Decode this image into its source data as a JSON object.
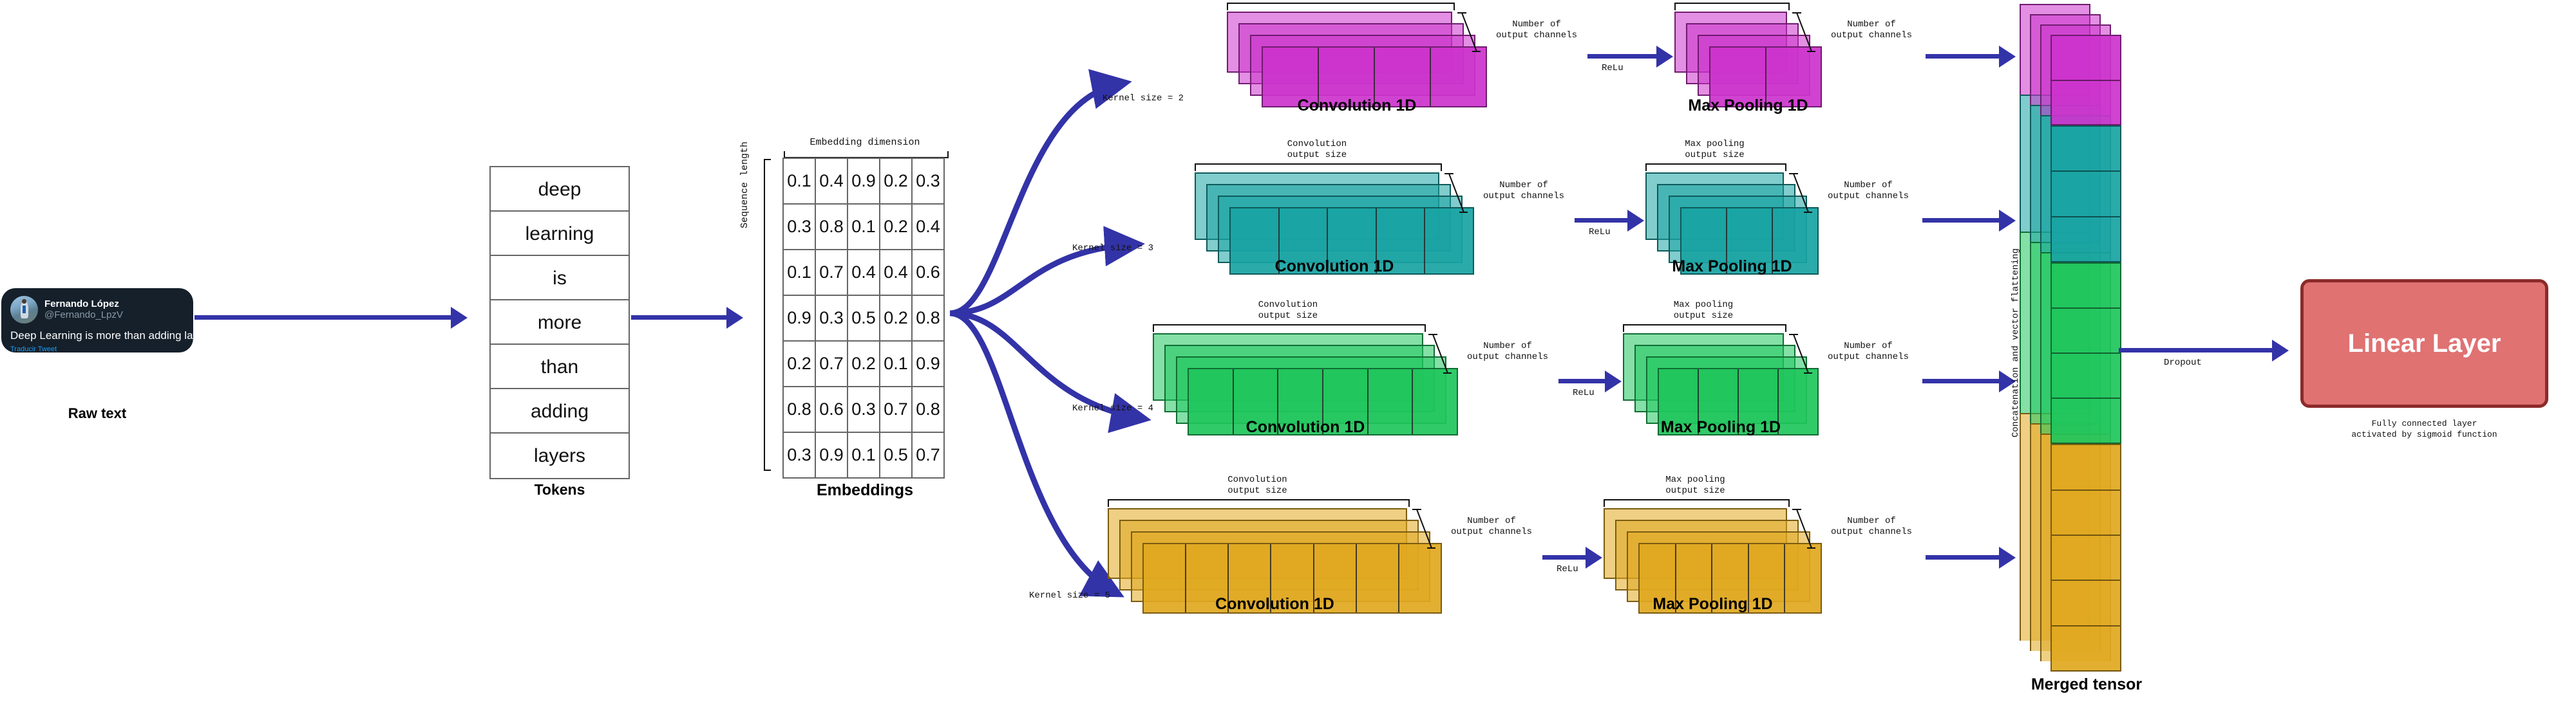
{
  "tweet": {
    "name": "Fernando López",
    "handle": "@Fernando_LpzV",
    "body": "Deep Learning is more than adding layers.",
    "translate": "Traducir Tweet",
    "caption": "Raw text"
  },
  "tokens": {
    "caption": "Tokens",
    "items": [
      "deep",
      "learning",
      "is",
      "more",
      "than",
      "adding",
      "layers"
    ]
  },
  "embeddings": {
    "caption": "Embeddings",
    "dim_label": "Embedding dimension",
    "seq_label": "Sequence length",
    "rows": [
      [
        "0.1",
        "0.4",
        "0.9",
        "0.2",
        "0.3"
      ],
      [
        "0.3",
        "0.8",
        "0.1",
        "0.2",
        "0.4"
      ],
      [
        "0.1",
        "0.7",
        "0.4",
        "0.4",
        "0.6"
      ],
      [
        "0.9",
        "0.3",
        "0.5",
        "0.2",
        "0.8"
      ],
      [
        "0.2",
        "0.7",
        "0.2",
        "0.1",
        "0.9"
      ],
      [
        "0.8",
        "0.6",
        "0.3",
        "0.7",
        "0.8"
      ],
      [
        "0.3",
        "0.9",
        "0.1",
        "0.5",
        "0.7"
      ]
    ]
  },
  "labels": {
    "conv_out_size": "Convolution\noutput size",
    "conv_out_size_l1": "Convolution",
    "conv_out_size_l2": "output size",
    "pool_out_size_l1": "Max pooling",
    "pool_out_size_l2": "output size",
    "num_channels_l1": "Number of",
    "num_channels_l2": "output channels",
    "relu": "ReLu",
    "dropout": "Dropout",
    "conv_caption": "Convolution 1D",
    "pool_caption": "Max Pooling 1D"
  },
  "branches": [
    {
      "kernel_label": "Kernel size = 2",
      "kernel_size": 2,
      "color": "#cc33cc",
      "conv_cells": 4,
      "pool_cells": 2
    },
    {
      "kernel_label": "Kernel size = 3",
      "kernel_size": 3,
      "color": "#19a3a3",
      "conv_cells": 5,
      "pool_cells": 3
    },
    {
      "kernel_label": "Kernel size = 4",
      "kernel_size": 4,
      "color": "#1fc65c",
      "conv_cells": 6,
      "pool_cells": 4
    },
    {
      "kernel_label": "Kernel size = 5",
      "kernel_size": 5,
      "color": "#e0a81f",
      "conv_cells": 7,
      "pool_cells": 5
    }
  ],
  "merged": {
    "caption": "Merged tensor",
    "rot_label": "Concatenation and vector flattening",
    "segments": [
      {
        "color": "#cc33cc",
        "cells": 2
      },
      {
        "color": "#19a3a3",
        "cells": 3
      },
      {
        "color": "#1fc65c",
        "cells": 4
      },
      {
        "color": "#e0a81f",
        "cells": 5
      }
    ]
  },
  "linear": {
    "label": "Linear Layer",
    "sub_l1": "Fully connected layer",
    "sub_l2": "activated by sigmoid function",
    "fill": "#e07272",
    "stroke": "#8c2a2a"
  },
  "accent": {
    "arrow": "#3333a8"
  }
}
